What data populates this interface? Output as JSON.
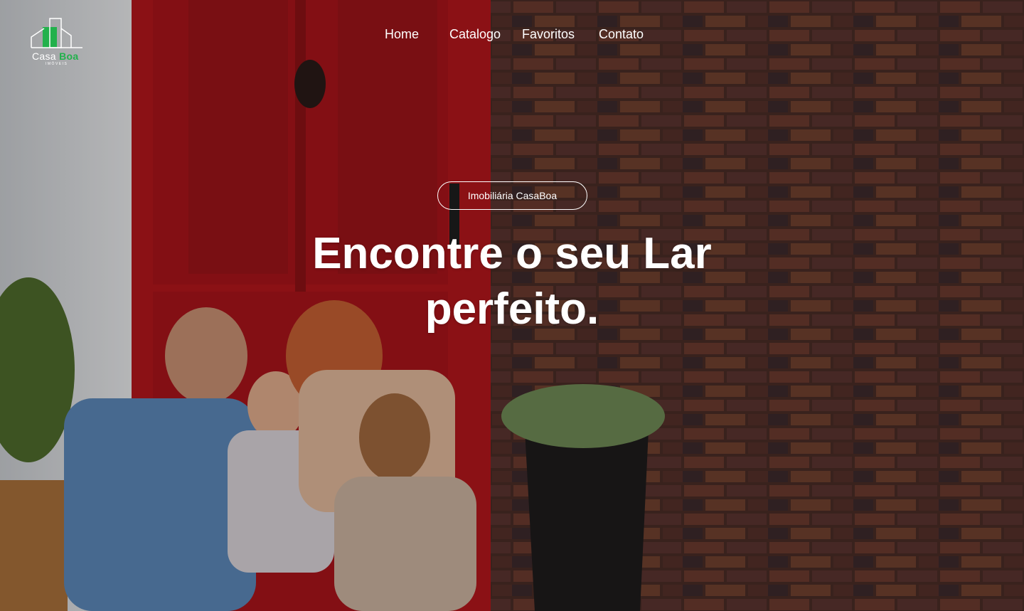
{
  "brand": {
    "name_part1": "Casa",
    "name_part2": "Boa",
    "subtitle": "IMÓVEIS",
    "accent_color": "#22b14c"
  },
  "nav": {
    "items": [
      {
        "label": "Home"
      },
      {
        "label": "Catalogo"
      },
      {
        "label": "Favoritos"
      },
      {
        "label": "Contato"
      }
    ]
  },
  "hero": {
    "badge": "Imobiliária CasaBoa",
    "headline": "Encontre o seu Lar perfeito."
  }
}
